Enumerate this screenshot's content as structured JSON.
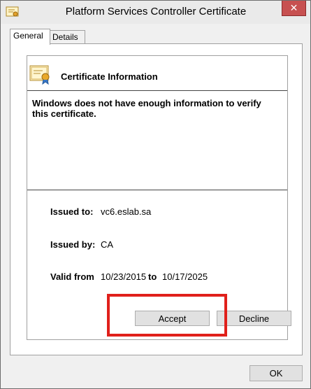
{
  "window": {
    "title": "Platform Services Controller Certificate",
    "close_label": "✕"
  },
  "tabs": [
    {
      "label": "General",
      "active": true
    },
    {
      "label": "Details",
      "active": false
    }
  ],
  "cert_info": {
    "heading": "Certificate Information",
    "warning": "Windows does not have enough information to verify this certificate.",
    "issued_to_label": "Issued to:",
    "issued_to_value": "vc6.eslab.sa",
    "issued_by_label": "Issued by:",
    "issued_by_value": "CA",
    "valid_from_label": "Valid from",
    "valid_from_value": "10/23/2015",
    "valid_to_label": "to",
    "valid_to_value": "10/17/2025"
  },
  "buttons": {
    "accept": "Accept",
    "decline": "Decline",
    "ok": "OK"
  },
  "colors": {
    "highlight": "#e0201b",
    "close": "#c75050"
  }
}
